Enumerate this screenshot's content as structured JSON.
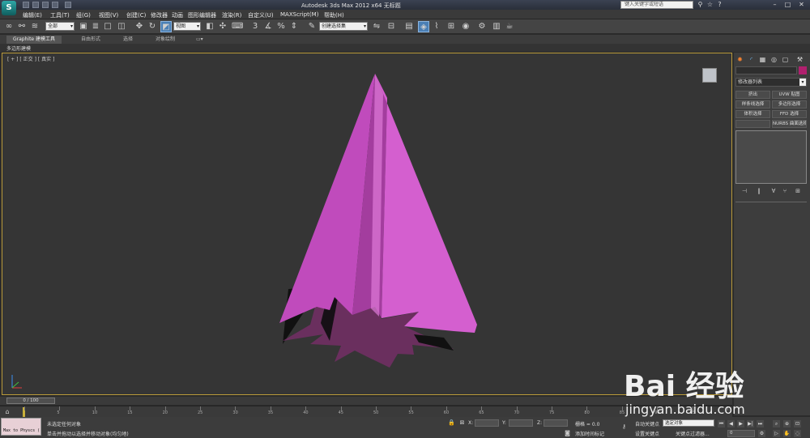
{
  "titlebar": {
    "title": "Autodesk 3ds Max  2012 x64       无标题",
    "search_placeholder": "键入关键字或短语",
    "logo_text": "S"
  },
  "menu": [
    "编辑(E)",
    "工具(T)",
    "组(G)",
    "视图(V)",
    "创建(C)",
    "修改器",
    "动画",
    "图形编辑器",
    "渲染(R)",
    "自定义(U)",
    "MAXScript(M)",
    "帮助(H)"
  ],
  "toolbar": {
    "filter_dropdown": "全部",
    "refcoord_dropdown": "视图",
    "selset_dropdown": "创建选择集"
  },
  "ribbon": {
    "tabs": [
      "Graphite 建模工具",
      "自由形式",
      "选择",
      "对象绘制"
    ],
    "subtab": "多边形建模"
  },
  "viewport": {
    "label": "[ + ] [ 正交 ] [ 真实 ]",
    "object_color": "#c83fb7"
  },
  "command_panel": {
    "modifier_list": "修改器列表",
    "buttons": [
      "挤出",
      "UVW 贴图",
      "样条线选择",
      "多边形选择",
      "体积选择",
      "FFD 选择",
      "",
      "NURBS 曲面选择"
    ]
  },
  "time": {
    "frame_display": "0 / 100",
    "ticks": [
      "0",
      "5",
      "10",
      "15",
      "20",
      "25",
      "30",
      "35",
      "40",
      "45",
      "50",
      "55",
      "60",
      "65",
      "70",
      "75",
      "80",
      "85",
      "90",
      "95",
      "100"
    ]
  },
  "status": {
    "maxscript_label": "Max to Physcs (",
    "line1": "未选定任何对象",
    "line2": "单击并拖动以选择并移动对象(均匀地)",
    "x_label": "X:",
    "y_label": "Y:",
    "z_label": "Z:",
    "grid": "栅格 = 0.0",
    "add_time_tag": "添加时间标记",
    "auto_key": "自动关键点",
    "set_key": "设置关键点",
    "selected_object": "选定对象",
    "key_filters": "关键点过滤器...",
    "frame_field": "0"
  },
  "watermark": {
    "brand": "Bai 经验",
    "url": "jingyan.baidu.com"
  }
}
